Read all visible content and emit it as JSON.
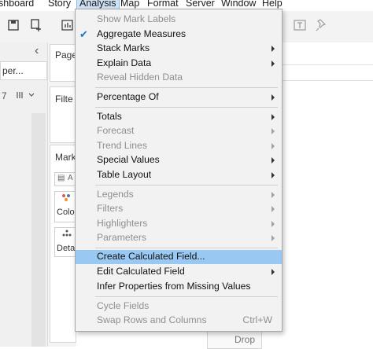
{
  "menubar": {
    "items": [
      {
        "label": "shboard",
        "active": false
      },
      {
        "label": "Story",
        "active": false
      },
      {
        "label": "Analysis",
        "active": true
      },
      {
        "label": "Map",
        "active": false
      },
      {
        "label": "Format",
        "active": false
      },
      {
        "label": "Server",
        "active": false
      },
      {
        "label": "Window",
        "active": false
      },
      {
        "label": "Help",
        "active": false
      }
    ]
  },
  "toolbar": {
    "icons": [
      "save-icon",
      "add-datasource-icon",
      "chart-icon",
      "text-icon",
      "pin-icon"
    ]
  },
  "left_pane": {
    "back_chevron": "‹",
    "pages_title": "Page",
    "datasource_hint": "per...",
    "filters_title": "Filte",
    "marks_title": "Mark",
    "marks_type": "A",
    "color_label": "Colo",
    "detail_label": "Deta",
    "drop_label": "Drop"
  },
  "analysis_menu": {
    "items": [
      {
        "label": "Show Mark Labels",
        "enabled": false,
        "submenu": false,
        "checked": false
      },
      {
        "label": "Aggregate Measures",
        "enabled": true,
        "submenu": false,
        "checked": true
      },
      {
        "label": "Stack Marks",
        "enabled": true,
        "submenu": true,
        "checked": false
      },
      {
        "label": "Explain Data",
        "enabled": true,
        "submenu": true,
        "checked": false
      },
      {
        "label": "Reveal Hidden Data",
        "enabled": false,
        "submenu": false,
        "checked": false
      },
      {
        "label": "Percentage Of",
        "enabled": true,
        "submenu": true,
        "checked": false
      },
      {
        "label": "Totals",
        "enabled": true,
        "submenu": true,
        "checked": false
      },
      {
        "label": "Forecast",
        "enabled": false,
        "submenu": true,
        "checked": false
      },
      {
        "label": "Trend Lines",
        "enabled": false,
        "submenu": true,
        "checked": false
      },
      {
        "label": "Special Values",
        "enabled": true,
        "submenu": true,
        "checked": false
      },
      {
        "label": "Table Layout",
        "enabled": true,
        "submenu": true,
        "checked": false
      },
      {
        "label": "Legends",
        "enabled": false,
        "submenu": true,
        "checked": false
      },
      {
        "label": "Filters",
        "enabled": false,
        "submenu": true,
        "checked": false
      },
      {
        "label": "Highlighters",
        "enabled": false,
        "submenu": true,
        "checked": false
      },
      {
        "label": "Parameters",
        "enabled": false,
        "submenu": true,
        "checked": false
      },
      {
        "label": "Create Calculated Field...",
        "enabled": true,
        "submenu": false,
        "checked": false,
        "highlighted": true
      },
      {
        "label": "Edit Calculated Field",
        "enabled": true,
        "submenu": true,
        "checked": false
      },
      {
        "label": "Infer Properties from Missing Values",
        "enabled": true,
        "submenu": false,
        "checked": false
      },
      {
        "label": "Cycle Fields",
        "enabled": false,
        "submenu": false,
        "checked": false
      },
      {
        "label": "Swap Rows and Columns",
        "enabled": false,
        "submenu": false,
        "checked": false,
        "shortcut": "Ctrl+W"
      }
    ]
  },
  "colors": {
    "highlight": "#99c9f2",
    "check": "#1a72c7",
    "menu_bg": "#f2f2f2",
    "disabled_text": "#8f8f8f"
  }
}
